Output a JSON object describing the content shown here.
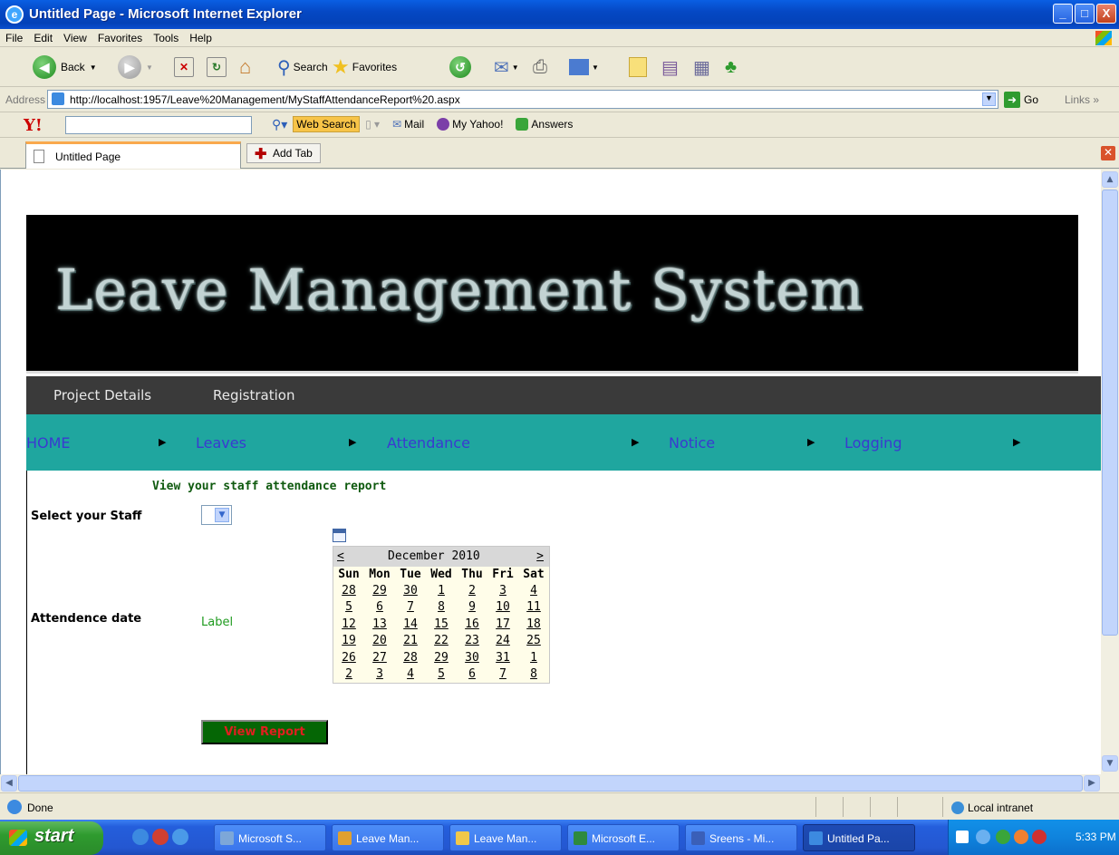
{
  "window": {
    "title": "Untitled Page - Microsoft Internet Explorer",
    "buttons": {
      "minimize": "_",
      "maximize": "□",
      "close": "X"
    }
  },
  "menu": [
    "File",
    "Edit",
    "View",
    "Favorites",
    "Tools",
    "Help"
  ],
  "toolbar": {
    "back": "Back",
    "search": "Search",
    "favorites": "Favorites"
  },
  "address": {
    "label": "Address",
    "url": "http://localhost:1957/Leave%20Management/MyStaffAttendanceReport%20.aspx",
    "go": "Go",
    "links": "Links"
  },
  "yahoo": {
    "logo": "Y!",
    "web_search": "Web Search",
    "mail": "Mail",
    "my_yahoo": "My Yahoo!",
    "answers": "Answers"
  },
  "tabs": {
    "active": "Untitled Page",
    "add": "Add Tab"
  },
  "page": {
    "banner_title": "Leave Management System",
    "nav1": [
      "Project Details",
      "Registration"
    ],
    "nav2": [
      "HOME",
      "Leaves",
      "Attendance",
      "Notice",
      "Logging"
    ],
    "heading": "View your staff attendance report",
    "select_staff_label": "Select your Staff",
    "attendance_label": "Attendence date",
    "label_text": "Label",
    "view_button": "View Report"
  },
  "calendar": {
    "prev": "<",
    "next": ">",
    "month": "December 2010",
    "days": [
      "Sun",
      "Mon",
      "Tue",
      "Wed",
      "Thu",
      "Fri",
      "Sat"
    ],
    "weeks": [
      [
        "28",
        "29",
        "30",
        "1",
        "2",
        "3",
        "4"
      ],
      [
        "5",
        "6",
        "7",
        "8",
        "9",
        "10",
        "11"
      ],
      [
        "12",
        "13",
        "14",
        "15",
        "16",
        "17",
        "18"
      ],
      [
        "19",
        "20",
        "21",
        "22",
        "23",
        "24",
        "25"
      ],
      [
        "26",
        "27",
        "28",
        "29",
        "30",
        "31",
        "1"
      ],
      [
        "2",
        "3",
        "4",
        "5",
        "6",
        "7",
        "8"
      ]
    ]
  },
  "status": {
    "text": "Done",
    "zone": "Local intranet"
  },
  "taskbar": {
    "start": "start",
    "tasks": [
      "Microsoft S...",
      "Leave Man...",
      "Leave Man...",
      "Microsoft E...",
      "Sreens - Mi...",
      "Untitled Pa..."
    ],
    "time": "5:33 PM"
  }
}
